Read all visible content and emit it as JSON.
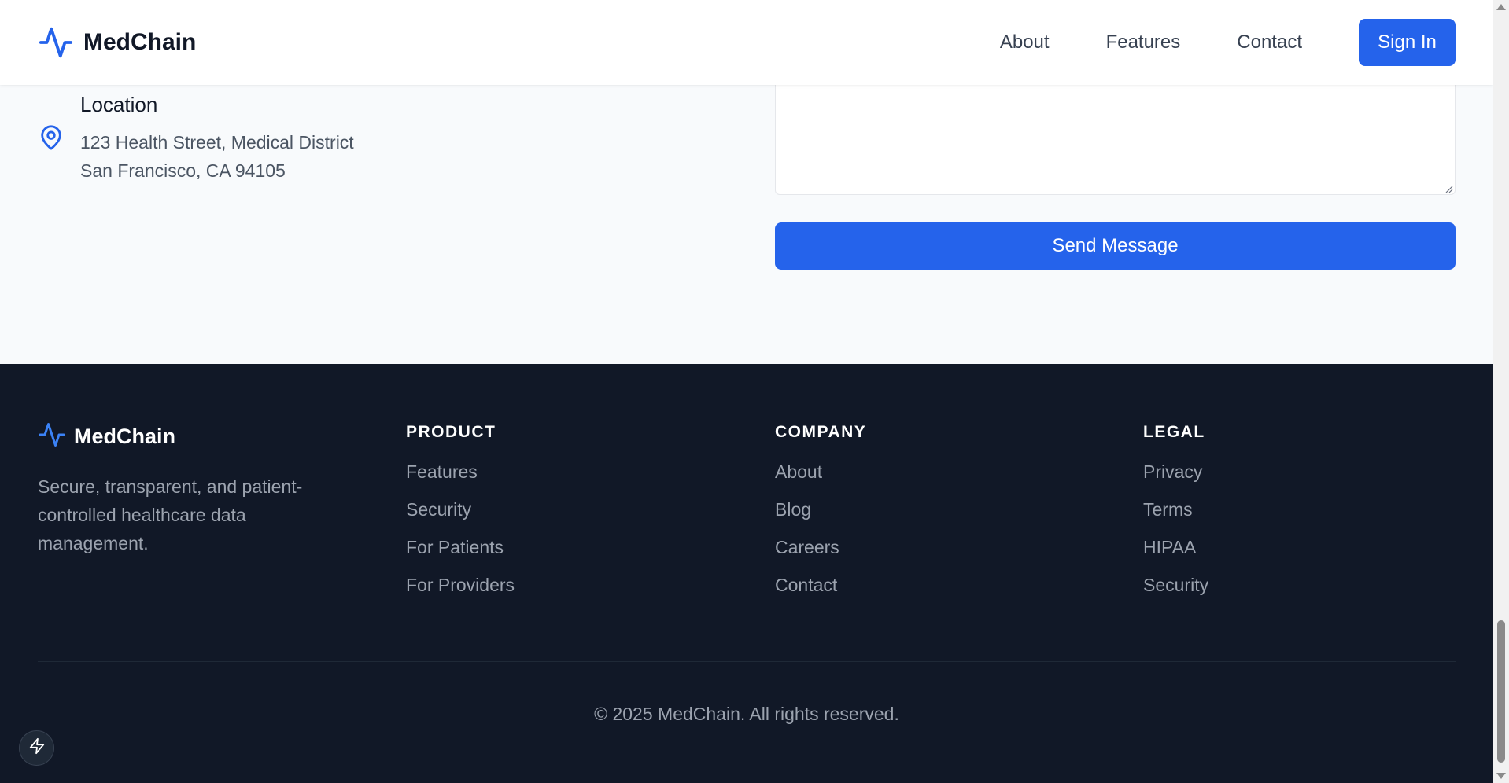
{
  "navbar": {
    "brand": "MedChain",
    "links": [
      "About",
      "Features",
      "Contact"
    ],
    "signin_label": "Sign In"
  },
  "contact": {
    "location_title": "Location",
    "address_line1": "123 Health Street, Medical District",
    "address_line2": "San Francisco, CA 94105",
    "send_label": "Send Message"
  },
  "footer": {
    "brand": "MedChain",
    "tagline": "Secure, transparent, and patient-controlled healthcare data management.",
    "columns": [
      {
        "title": "PRODUCT",
        "links": [
          "Features",
          "Security",
          "For Patients",
          "For Providers"
        ]
      },
      {
        "title": "COMPANY",
        "links": [
          "About",
          "Blog",
          "Careers",
          "Contact"
        ]
      },
      {
        "title": "LEGAL",
        "links": [
          "Privacy",
          "Terms",
          "HIPAA",
          "Security"
        ]
      }
    ],
    "copyright": "© 2025 MedChain. All rights reserved."
  },
  "colors": {
    "accent": "#2563eb",
    "footer_bg": "#111827",
    "page_bg": "#f8fafc"
  },
  "icons": {
    "brand": "activity-pulse-icon",
    "location": "map-pin-icon",
    "floating": "bolt-icon"
  }
}
